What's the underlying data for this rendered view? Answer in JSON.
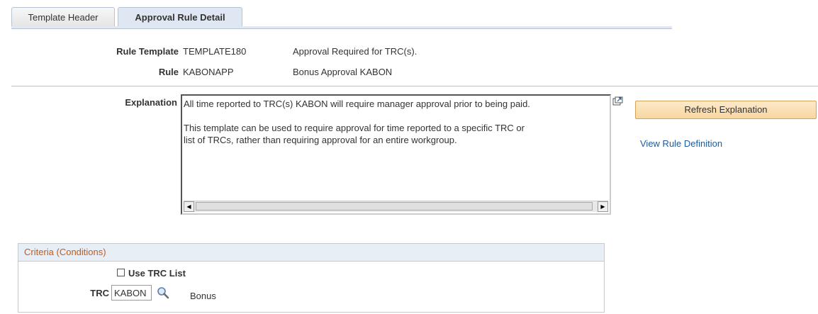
{
  "tabs": [
    {
      "label": "Template Header",
      "active": false
    },
    {
      "label": "Approval Rule Detail",
      "active": true
    }
  ],
  "rule_template": {
    "label": "Rule Template",
    "code": "TEMPLATE180",
    "description": "Approval Required for TRC(s)."
  },
  "rule": {
    "label": "Rule",
    "code": "KABONAPP",
    "description": "Bonus Approval KABON"
  },
  "explanation": {
    "label": "Explanation",
    "text": "All time reported to TRC(s) KABON will require manager approval prior to being paid.\n\nThis template can be used to require approval for time reported to a specific TRC or\nlist of TRCs, rather than requiring approval for an entire workgroup.",
    "expand_icon": "expand-window-icon"
  },
  "actions": {
    "refresh_label": "Refresh Explanation",
    "view_rule_label": "View Rule Definition"
  },
  "criteria": {
    "header": "Criteria (Conditions)",
    "use_trc_list_label": "Use TRC List",
    "use_trc_list_checked": false,
    "trc_label": "TRC",
    "trc_value": "KABON",
    "trc_description": "Bonus",
    "lookup_icon": "magnifier-icon"
  },
  "colors": {
    "accent_link": "#1d5b99",
    "group_header_text": "#c25a1e",
    "button_bg": "#f8d6a0"
  }
}
